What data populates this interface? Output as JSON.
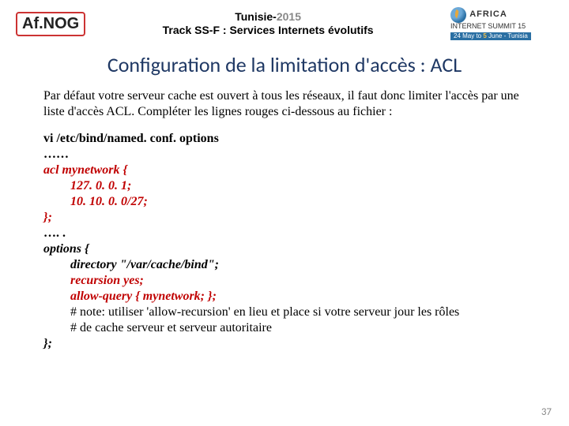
{
  "header": {
    "logo_left": "Af.NOG",
    "center_prefix": "Tunisie-",
    "center_year": "2015",
    "center_line2": "Track SS-F : Services Internets évolutifs",
    "right_brand": "AFRICA",
    "right_sub": "INTERNET SUMMIT 15",
    "right_dates_a": "24 May to ",
    "right_dates_b": "5",
    "right_dates_c": " June - Tunisia"
  },
  "title": "Configuration de la limitation d'accès : ACL",
  "intro": "Par défaut votre serveur cache est ouvert à tous les réseaux, il faut donc limiter l'accès par une liste d'accès ACL. Compléter les lignes rouges ci-dessous au fichier :",
  "cmd": " vi /etc/bind/named. conf. options",
  "ellipsis1": "……",
  "acl_open": "acl mynetwork {",
  "acl_ip1": "127. 0. 0. 1;",
  "acl_ip2": "10. 10. 0. 0/27;",
  "acl_close": "};",
  "ellipsis2": "…. .",
  "opt_open": "options {",
  "opt_dir": "directory \"/var/cache/bind\";",
  "opt_rec": "recursion yes;",
  "opt_allow": "allow-query { mynetwork; };",
  "note1": "# note: utiliser 'allow-recursion' en lieu et place si votre serveur jour les rôles",
  "note2": "# de cache serveur et serveur  autoritaire",
  "opt_close": "};",
  "page_number": "37"
}
